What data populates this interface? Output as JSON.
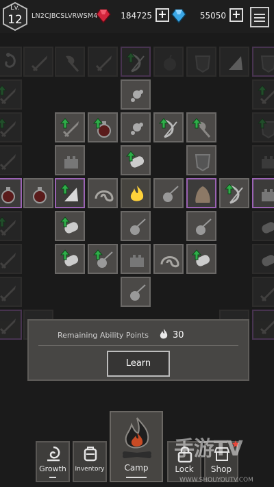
{
  "player": {
    "level_label": "Lv.",
    "level": "12",
    "id": "LN2CJBCSLVRWSM4"
  },
  "currency": [
    {
      "name": "red-gem",
      "amount": "184725",
      "color": "#d2253c"
    },
    {
      "name": "blue-gem",
      "amount": "55050",
      "color": "#3ba7e6"
    }
  ],
  "panel": {
    "label": "Remaining Ability Points",
    "points": "30",
    "learn_label": "Learn"
  },
  "nav": [
    {
      "label": "Growth",
      "icon": "spiral-icon"
    },
    {
      "label": "Inventory",
      "icon": "backpack-icon"
    },
    {
      "label": "Camp",
      "icon": "campfire-icon"
    },
    {
      "label": "Lock",
      "icon": "lock-icon"
    },
    {
      "label": "Shop",
      "icon": "shop-icon"
    }
  ],
  "watermark": {
    "main": "手游TV",
    "sub": "WWW.SHOUYOUTV.COM"
  },
  "colors": {
    "highlight": "#9a63b3",
    "upgrade": "#2fae4a",
    "flame": "#ffd23a"
  }
}
